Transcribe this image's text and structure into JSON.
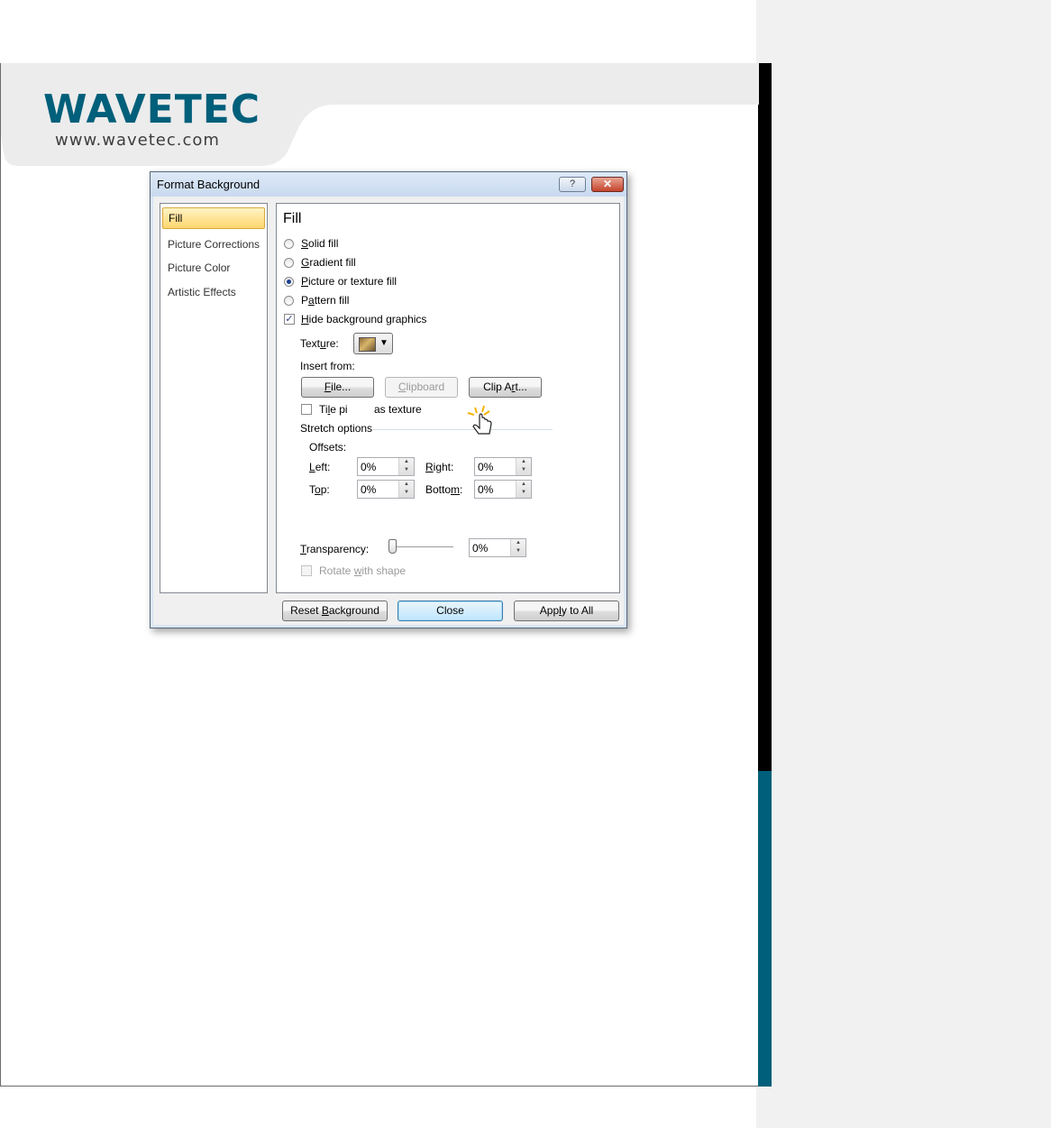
{
  "brand": {
    "logo_text": "WAVETEC",
    "registered_mark": "®",
    "url": "www.wavetec.com"
  },
  "colors": {
    "brand_teal": "#005f7a",
    "dialog_frame": "#dae6f4",
    "selected_nav": "#ffd66e"
  },
  "dialog": {
    "title": "Format Background",
    "help_icon": "help-icon",
    "help_glyph": "?",
    "close_glyph": "✕",
    "nav": [
      {
        "label": "Fill",
        "selected": true
      },
      {
        "label": "Picture Corrections",
        "selected": false
      },
      {
        "label": "Picture Color",
        "selected": false
      },
      {
        "label": "Artistic Effects",
        "selected": false
      }
    ],
    "fill": {
      "heading": "Fill",
      "options": [
        {
          "label_pre": "",
          "label_key": "S",
          "label_post": "olid fill",
          "selected": false
        },
        {
          "label_pre": "",
          "label_key": "G",
          "label_post": "radient fill",
          "selected": false
        },
        {
          "label_pre": "",
          "label_key": "P",
          "label_post": "icture or texture fill",
          "selected": true
        },
        {
          "label_pre": "P",
          "label_key": "a",
          "label_post": "ttern fill",
          "selected": false
        }
      ],
      "hide_bg": {
        "label_pre": "",
        "label_key": "H",
        "label_post": "ide background graphics",
        "checked": true
      },
      "texture_label_pre": "Text",
      "texture_label_key": "u",
      "texture_label_post": "re:",
      "texture_icon": "texture-swatch-icon",
      "insert_from_label": "Insert from:",
      "file_btn": {
        "pre": "",
        "key": "F",
        "post": "ile..."
      },
      "clipboard_btn": {
        "pre": "",
        "key": "C",
        "post": "lipboard"
      },
      "clipart_btn": {
        "pre": "Clip A",
        "key": "r",
        "post": "t..."
      },
      "tile_label_a": "Ti",
      "tile_label_key": "l",
      "tile_label_b": "e pi",
      "tile_label_c": "as texture",
      "stretch_label": "Stretch options",
      "offsets_label": "Offsets:",
      "left": {
        "pre": "",
        "key": "L",
        "post": "eft:",
        "value": "0%"
      },
      "right": {
        "pre": "",
        "key": "R",
        "post": "ight:",
        "value": "0%"
      },
      "top": {
        "pre": "T",
        "key": "o",
        "post": "p:",
        "value": "0%"
      },
      "bottom": {
        "pre": "Botto",
        "key": "m",
        "post": ":",
        "value": "0%"
      },
      "transparency": {
        "pre": "",
        "key": "T",
        "post": "ransparency:",
        "value": "0%",
        "level": 0
      },
      "rotate": {
        "pre": "Rotate ",
        "key": "w",
        "post": "ith shape",
        "checked": false,
        "disabled": true
      }
    },
    "footer": {
      "reset": {
        "pre": "Reset ",
        "key": "B",
        "post": "ackground"
      },
      "close": "Close",
      "apply": {
        "pre": "App",
        "key": "l",
        "post": "y to All"
      }
    }
  }
}
